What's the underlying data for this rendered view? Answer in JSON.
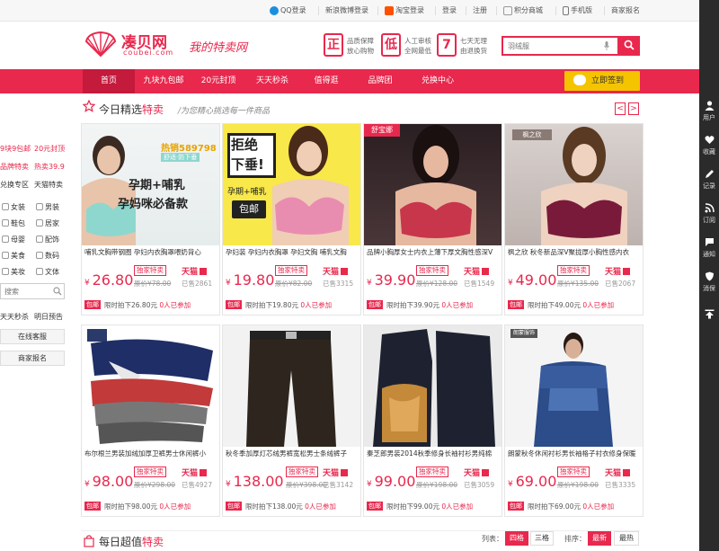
{
  "topbar": {
    "qq_login": "QQ登录",
    "weibo_login": "新浪微博登录",
    "taobao_login": "淘宝登录",
    "login": "登录",
    "register": "注册",
    "points_mall": "积分商城",
    "mobile": "手机版",
    "merchant_signup": "商家报名"
  },
  "header": {
    "logo_text": "凑贝网",
    "logo_sub": "coubei.com",
    "slogan": "我的特卖网",
    "features": [
      {
        "char": "正",
        "line1": "品质保障",
        "line2": "放心购物"
      },
      {
        "char": "低",
        "line1": "人工审核",
        "line2": "全网最低"
      },
      {
        "char": "7",
        "line1": "七天无理",
        "line2": "由退换货"
      }
    ],
    "search_placeholder": "羽绒服"
  },
  "nav": {
    "items": [
      "首页",
      "九块九包邮",
      "20元封顶",
      "天天秒杀",
      "值得逛",
      "品牌团",
      "兑换中心"
    ],
    "checkin": "立即签到"
  },
  "section1": {
    "title_prefix": "今日精选",
    "title_highlight": "特卖",
    "subtitle": "/为您精心挑选每一件商品",
    "prev": "<",
    "next": ">"
  },
  "leftbar": {
    "row1": [
      "9块9包邮",
      "20元封顶"
    ],
    "row2": [
      "品牌特卖",
      "热卖39.9"
    ],
    "row3": [
      "兑换专区",
      "天猫特卖"
    ],
    "cats": [
      [
        "女装",
        "男装"
      ],
      [
        "鞋包",
        "居家"
      ],
      [
        "母婴",
        "配饰"
      ],
      [
        "美食",
        "数码"
      ],
      [
        "美妆",
        "文体"
      ]
    ],
    "search_placeholder": "搜索",
    "row_bottom": [
      "天天秒杀",
      "明日预告"
    ],
    "service": "在线客服",
    "report": "商家报名"
  },
  "products": [
    {
      "title": "哺乳文胸带钢圈 孕妇内衣胸罩喂奶背心",
      "price": "26.80",
      "orig": "原价¥78.00",
      "sold": "已售2861",
      "exclusive": "独家特卖",
      "mall": "天猫",
      "bottom": "限时拍下26.80元",
      "join": "0人已参加",
      "badge": "热销589798",
      "badge2": "舒适·防下垂",
      "text1": "孕期+哺乳",
      "text2": "孕妈咪必备款"
    },
    {
      "title": "孕妇装 孕妇内衣胸罩 孕妇文胸 哺乳文胸",
      "price": "19.80",
      "orig": "原价¥82.00",
      "sold": "已售3315",
      "exclusive": "独家特卖",
      "mall": "天猫",
      "bottom": "限时拍下19.80元",
      "join": "0人已参加",
      "text1": "拒绝",
      "text2": "下垂!",
      "text3": "孕期+哺乳",
      "text4": "包邮"
    },
    {
      "title": "品牌小胸厚女士内衣上薄下厚文胸性感深V",
      "price": "39.90",
      "orig": "原价¥128.00",
      "sold": "已售1549",
      "exclusive": "独家特卖",
      "mall": "天猫",
      "bottom": "限时拍下39.90元",
      "join": "0人已参加",
      "brand": "舒宝娜"
    },
    {
      "title": "枫之欣 秋冬新品深V聚拢厚小胸性感内衣",
      "price": "49.00",
      "orig": "原价¥135.00",
      "sold": "已售2067",
      "exclusive": "独家特卖",
      "mall": "天猫",
      "bottom": "限时拍下49.00元",
      "join": "0人已参加",
      "brand": "枫之欣"
    },
    {
      "title": "布尔根兰男装加绒加厚卫裤男士休闲裤小",
      "price": "98.00",
      "orig": "原价¥298.00",
      "sold": "已售4927",
      "exclusive": "独家特卖",
      "mall": "天猫",
      "bottom": "限时拍下98.00元",
      "join": "0人已参加"
    },
    {
      "title": "秋冬季加厚灯芯绒男裤宽松男士条绒裤子",
      "price": "138.00",
      "orig": "原价¥398.00",
      "sold": "已售3142",
      "exclusive": "独家特卖",
      "mall": "天猫",
      "bottom": "限时拍下138.00元",
      "join": "0人已参加"
    },
    {
      "title": "秦芝郎男装2014秋季修身长袖衬衫男纯棉",
      "price": "99.00",
      "orig": "原价¥198.00",
      "sold": "已售3059",
      "exclusive": "独家特卖",
      "mall": "天猫",
      "bottom": "限时拍下99.00元",
      "join": "0人已参加"
    },
    {
      "title": "朗蒙秋冬休闲衬衫男长袖格子衬衣修身保暖",
      "price": "69.00",
      "orig": "原价¥198.00",
      "sold": "已售3335",
      "exclusive": "独家特卖",
      "mall": "天猫",
      "bottom": "限时拍下69.00元",
      "join": "0人已参加",
      "brand": "朗蒙服饰"
    }
  ],
  "section2": {
    "title_prefix": "每日超值",
    "title_highlight": "特卖",
    "list_label": "列表：",
    "four_col": "四格",
    "three_col": "三格",
    "sort_label": "排序：",
    "newest": "最新",
    "hottest": "最热"
  },
  "sidebar": [
    "用户",
    "收藏",
    "记录",
    "订阅",
    "通知",
    "消保",
    ""
  ],
  "colors": {
    "brand": "#e8284d",
    "nav_active": "#c41a3c",
    "checkin": "#f5c400"
  }
}
